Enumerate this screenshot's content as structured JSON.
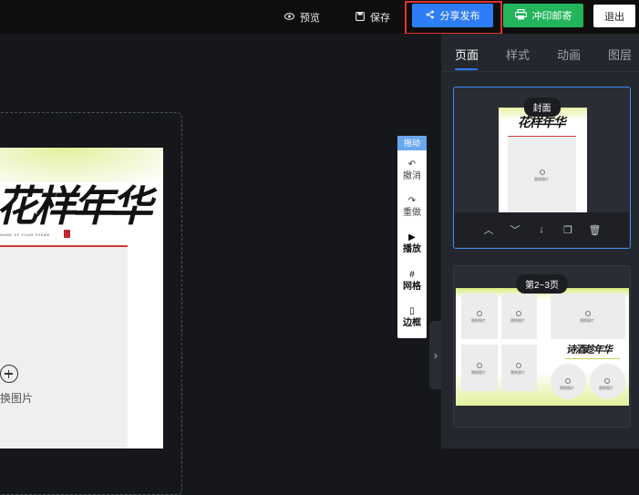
{
  "topbar": {
    "preview_label": "预览",
    "save_label": "保存",
    "share_label": "分享发布",
    "print_label": "冲印邮寄",
    "exit_label": "退出",
    "accent_colors": {
      "share": "#2f7df6",
      "print": "#23b45c",
      "highlight_outline": "#e1302c"
    }
  },
  "canvas": {
    "cover_title": "花样年华",
    "cover_subtitle": "NAME OF YOUR THEME",
    "slot_label": "换图片"
  },
  "vtool": {
    "drag_label": "拖动",
    "items": [
      {
        "icon": "undo-icon",
        "glyph": "↶",
        "label": "撤消"
      },
      {
        "icon": "redo-icon",
        "glyph": "↷",
        "label": "重做"
      },
      {
        "icon": "play-icon",
        "glyph": "▶",
        "label": "播放"
      },
      {
        "icon": "grid-icon",
        "glyph": "#",
        "label": "网格"
      },
      {
        "icon": "phone-frame-icon",
        "glyph": "▯",
        "label": "边框"
      }
    ]
  },
  "panel": {
    "tabs": [
      {
        "label": "页面",
        "active": true
      },
      {
        "label": "样式",
        "active": false
      },
      {
        "label": "动画",
        "active": false
      },
      {
        "label": "图层",
        "active": false
      }
    ],
    "pages": [
      {
        "badge": "封面",
        "title": "花样年华",
        "slot_label": "替换图片",
        "selected": true
      },
      {
        "badge": "第2~3页",
        "title": "诗酒趁年华",
        "slot_label": "替换图片",
        "selected": false
      }
    ],
    "actions": [
      "move-up-icon",
      "move-down-icon",
      "download-icon",
      "copy-icon",
      "delete-icon"
    ]
  }
}
